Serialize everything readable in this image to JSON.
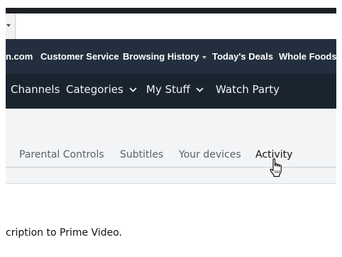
{
  "nav_belt": {
    "items": [
      {
        "label": "n.com"
      },
      {
        "label": "Customer Service"
      },
      {
        "label": "Browsing History",
        "has_dropdown": true
      },
      {
        "label": "Today's Deals"
      },
      {
        "label": "Whole Foods"
      }
    ]
  },
  "prime_nav": {
    "items": [
      {
        "label": "Channels"
      },
      {
        "label": "Categories",
        "has_dropdown": true
      },
      {
        "label": "My Stuff",
        "has_dropdown": true
      },
      {
        "label": "Watch Party"
      }
    ]
  },
  "settings_tabs": {
    "items": [
      {
        "label": "Parental Controls"
      },
      {
        "label": "Subtitles"
      },
      {
        "label": "Your devices"
      },
      {
        "label": "Activity",
        "active": true
      }
    ]
  },
  "content": {
    "text": "cription to Prime Video."
  },
  "icons": {
    "cursor": "hand-pointer-icon",
    "dropdown": "chevron-down-icon"
  },
  "colors": {
    "nav_belt_bg": "#232f3e",
    "prime_nav_bg": "#1a242f",
    "subheader_bg": "#f2f4f6"
  }
}
